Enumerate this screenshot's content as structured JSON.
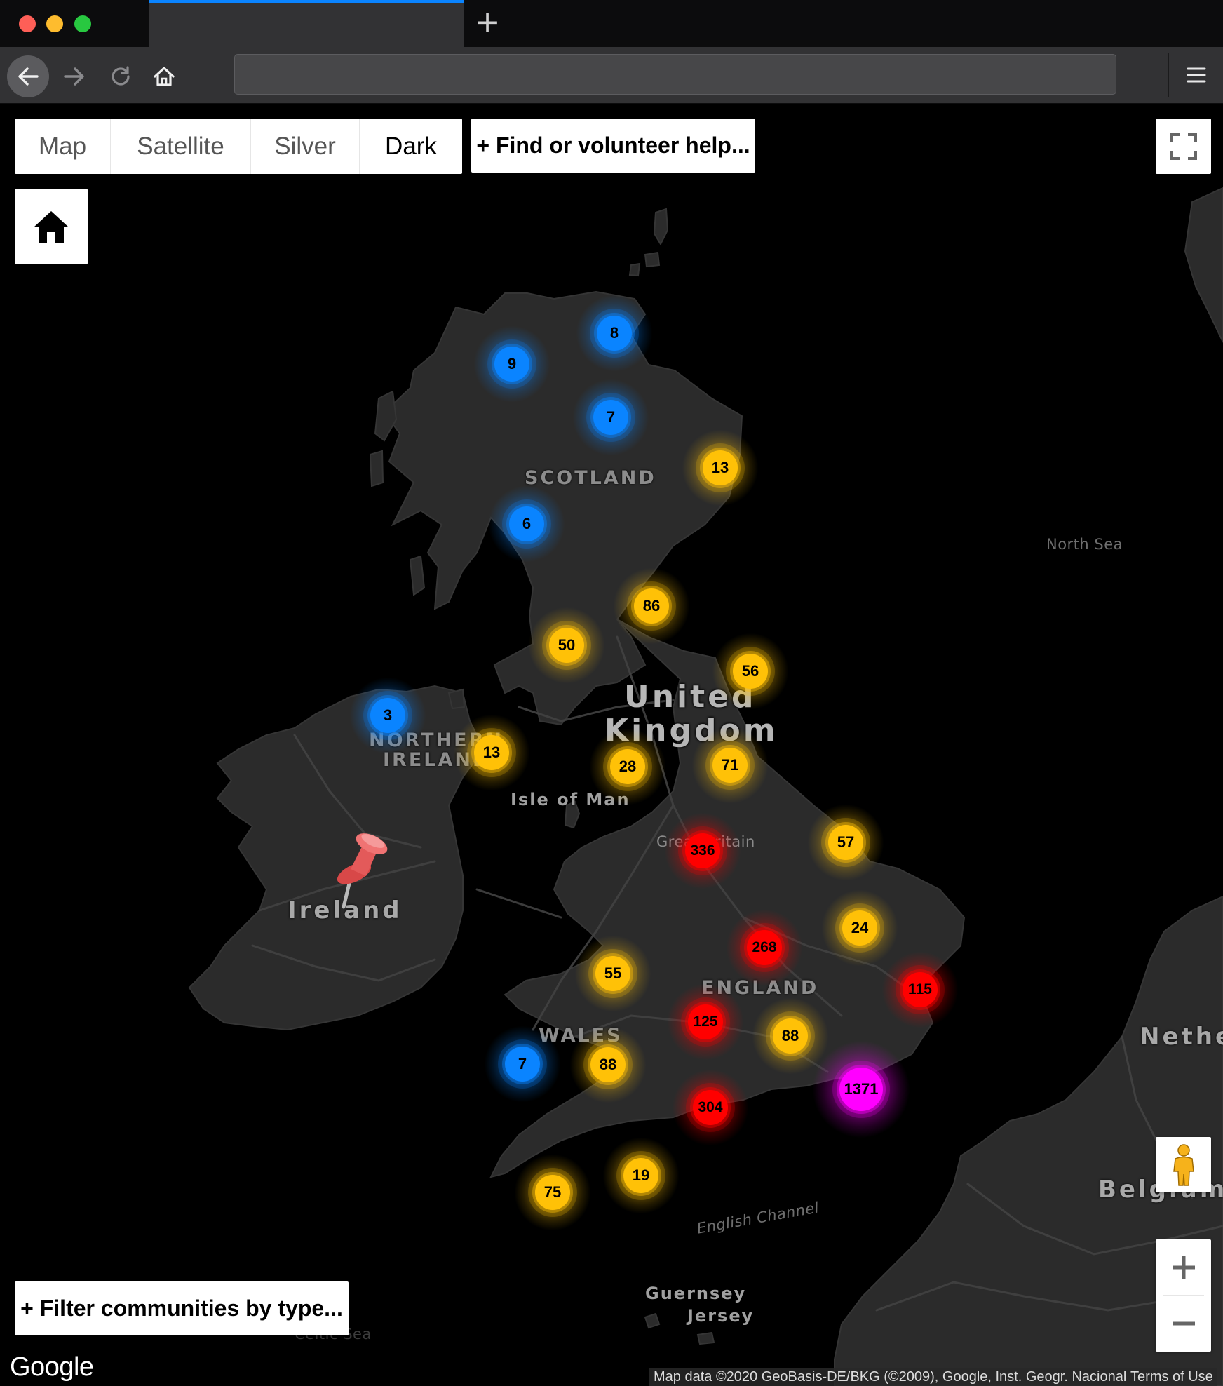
{
  "browser": {
    "url": "",
    "traffic_colors": [
      "#fe5f57",
      "#febc2e",
      "#28c840"
    ],
    "accent_color": "#0a84ff"
  },
  "map": {
    "type_buttons": [
      {
        "label": "Map",
        "active": false
      },
      {
        "label": "Satellite",
        "active": false
      },
      {
        "label": "Silver",
        "active": false
      },
      {
        "label": "Dark",
        "active": true
      }
    ],
    "find_help_label": "+ Find or volunteer help...",
    "filter_label": "+ Filter communities by type...",
    "labels": {
      "scotland": "SCOTLAND",
      "united": "United",
      "kingdom": "Kingdom",
      "northern": "NORTHERN",
      "ireland_region": "IRELAND",
      "isle_of_man": "Isle of Man",
      "great_britain": "Great Britain",
      "ireland": "Ireland",
      "england": "ENGLAND",
      "wales": "WALES",
      "netherlands": "Nethe",
      "belgium": "Belgium",
      "north_sea": "North Sea",
      "english_channel": "English Channel",
      "guernsey": "Guernsey",
      "jersey": "Jersey",
      "celtic_sea": "Celtic Sea"
    },
    "cluster_colors": {
      "blue": "#0a84ff",
      "yellow": "#ffc107",
      "red": "#ff0000",
      "magenta": "#ff00ff"
    },
    "clusters": [
      {
        "count": "8",
        "color": "blue"
      },
      {
        "count": "9",
        "color": "blue"
      },
      {
        "count": "7",
        "color": "blue"
      },
      {
        "count": "13",
        "color": "yellow"
      },
      {
        "count": "6",
        "color": "blue"
      },
      {
        "count": "86",
        "color": "yellow"
      },
      {
        "count": "50",
        "color": "yellow"
      },
      {
        "count": "56",
        "color": "yellow"
      },
      {
        "count": "3",
        "color": "blue"
      },
      {
        "count": "13",
        "color": "yellow"
      },
      {
        "count": "28",
        "color": "yellow"
      },
      {
        "count": "71",
        "color": "yellow"
      },
      {
        "count": "336",
        "color": "red"
      },
      {
        "count": "57",
        "color": "yellow"
      },
      {
        "count": "268",
        "color": "red"
      },
      {
        "count": "24",
        "color": "yellow"
      },
      {
        "count": "55",
        "color": "yellow"
      },
      {
        "count": "115",
        "color": "red"
      },
      {
        "count": "125",
        "color": "red"
      },
      {
        "count": "88",
        "color": "yellow"
      },
      {
        "count": "7",
        "color": "blue"
      },
      {
        "count": "88",
        "color": "yellow"
      },
      {
        "count": "1371",
        "color": "magenta"
      },
      {
        "count": "304",
        "color": "red"
      },
      {
        "count": "75",
        "color": "yellow"
      },
      {
        "count": "19",
        "color": "yellow"
      }
    ],
    "attribution": "Map data ©2020 GeoBasis-DE/BKG (©2009), Google, Inst. Geogr. Nacional",
    "terms": "Terms of Use",
    "google_logo": "Google"
  }
}
